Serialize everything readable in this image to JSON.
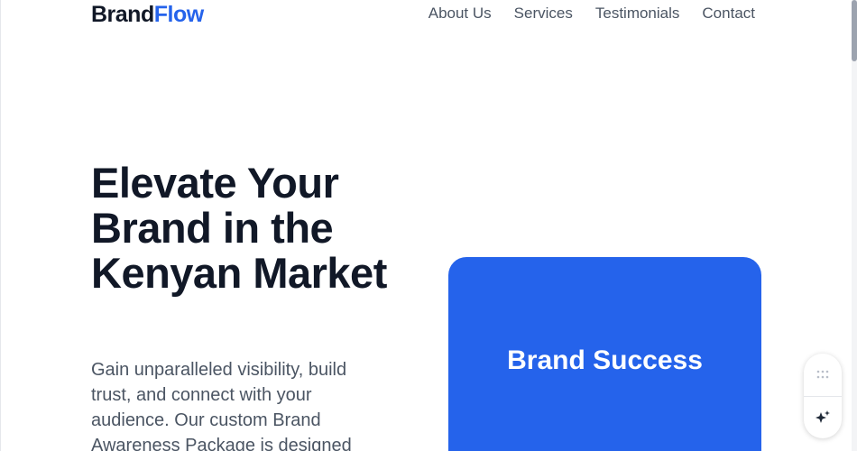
{
  "brand": {
    "part1": "Brand",
    "part2": "Flow",
    "accent_color": "#2563eb"
  },
  "nav": {
    "items": [
      {
        "label": "About Us"
      },
      {
        "label": "Services"
      },
      {
        "label": "Testimonials"
      },
      {
        "label": "Contact"
      }
    ]
  },
  "hero": {
    "title": "Elevate Your Brand in the Kenyan Market",
    "text": "Gain unparalleled visibility, build trust, and connect with your audience. Our custom Brand Awareness Package is designed",
    "card_label": "Brand Success",
    "card_color": "#2563eb"
  },
  "widget": {
    "top_icon": "grip-dots-icon",
    "bottom_icon": "sparkle-icon"
  }
}
